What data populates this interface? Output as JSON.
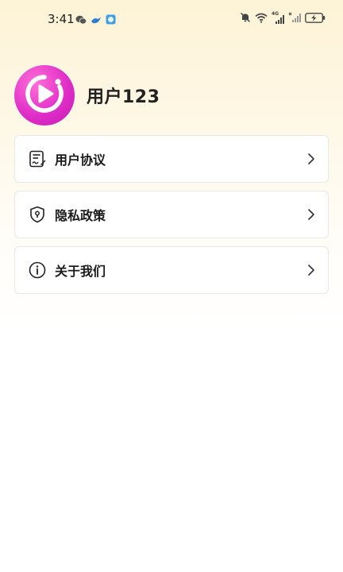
{
  "status_bar": {
    "time": "3:41",
    "notification_icons": [
      "wechat-icon",
      "bird-app-icon",
      "circle-app-icon"
    ],
    "system_icons": [
      "mute-bell-icon",
      "wifi-icon",
      "signal-4g-icon",
      "signal-no-sim-icon",
      "battery-charging-icon"
    ],
    "signal_label": "4G"
  },
  "profile": {
    "avatar_icon": "play-circle-icon",
    "username": "用户123",
    "accent_color": "#e02fc8"
  },
  "menu": {
    "items": [
      {
        "label": "用户协议",
        "icon": "agreement-document-icon"
      },
      {
        "label": "隐私政策",
        "icon": "privacy-shield-icon"
      },
      {
        "label": "关于我们",
        "icon": "info-circle-icon"
      }
    ]
  }
}
